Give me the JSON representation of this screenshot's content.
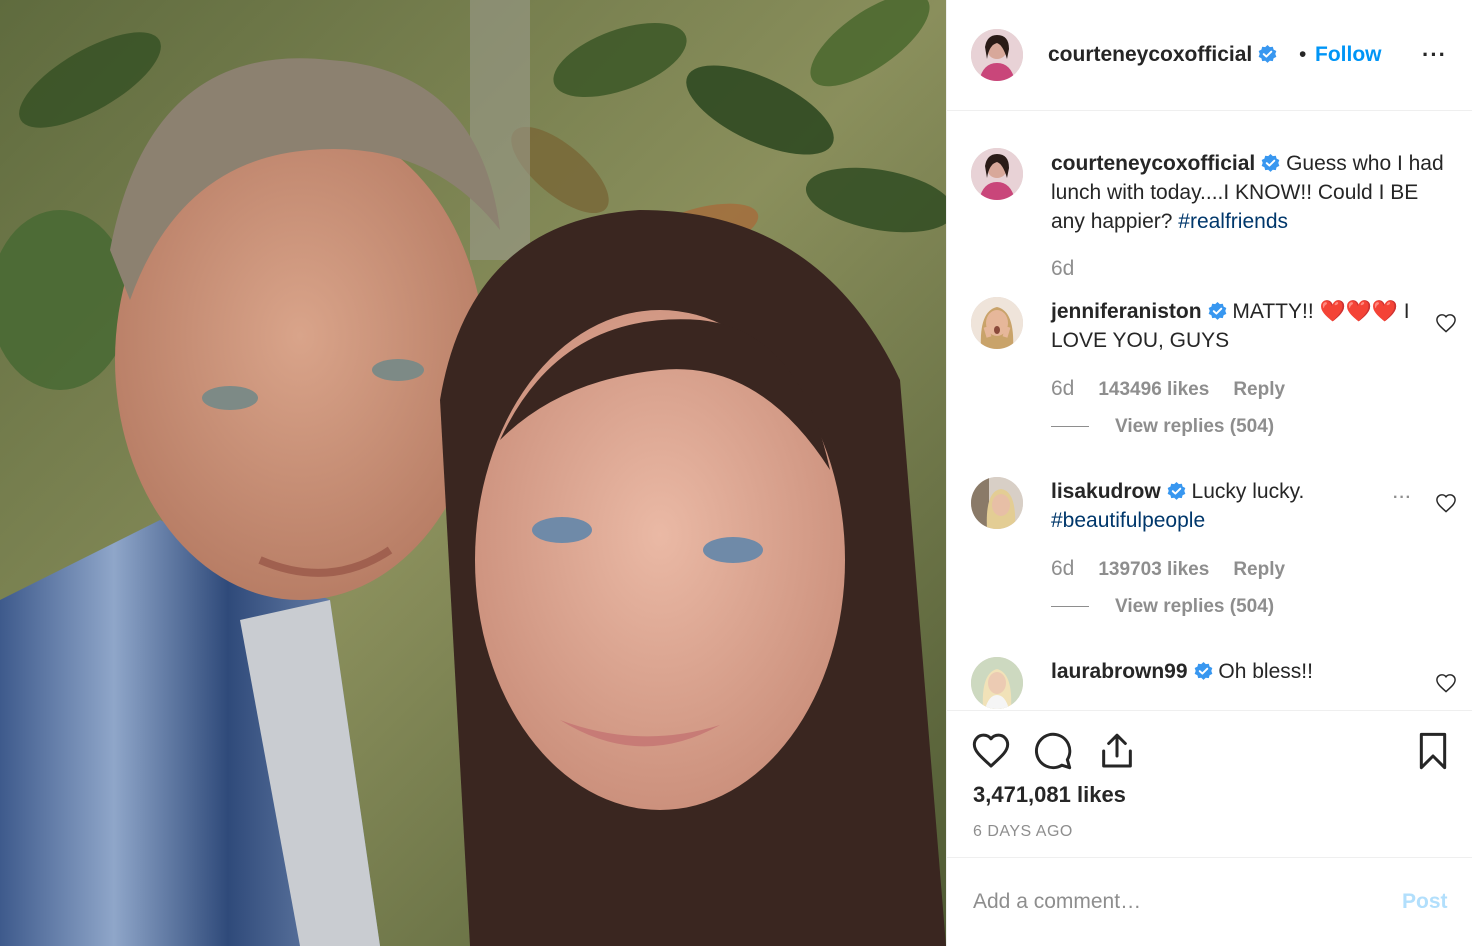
{
  "post": {
    "author": "courteneycoxofficial",
    "follow_label": "Follow",
    "separator": "•",
    "more_label": "···"
  },
  "caption": {
    "user": "courteneycoxofficial",
    "text": "Guess who I had lunch with today....I KNOW!! Could I BE any happier?",
    "hashtag": "#realfriends",
    "age": "6d"
  },
  "comments": [
    {
      "user": "jenniferaniston",
      "text": "MATTY!! ❤️❤️❤️ I LOVE YOU, GUYS",
      "age": "6d",
      "likes": "143496 likes",
      "reply_label": "Reply",
      "view_replies": "View replies (504)"
    },
    {
      "user": "lisakudrow",
      "text": "Lucky lucky.",
      "hashtag": "#beautifulpeople",
      "age": "6d",
      "likes": "139703 likes",
      "reply_label": "Reply",
      "view_replies": "View replies (504)",
      "more_label": "···"
    },
    {
      "user": "laurabrown99",
      "text": "Oh bless!!"
    }
  ],
  "stats": {
    "likes": "3,471,081 likes",
    "date": "6 DAYS AGO"
  },
  "composer": {
    "placeholder": "Add a comment…",
    "post_label": "Post"
  },
  "icons": {
    "verified": "verified-badge-icon",
    "like": "heart-icon",
    "comment": "comment-bubble-icon",
    "share": "share-icon",
    "save": "bookmark-icon",
    "comment_like": "small-heart-icon"
  },
  "colors": {
    "link_blue": "#0095f6",
    "hashtag": "#00376b",
    "muted": "#8e8e8e",
    "text": "#262626",
    "post_disabled": "#b2dffc"
  }
}
